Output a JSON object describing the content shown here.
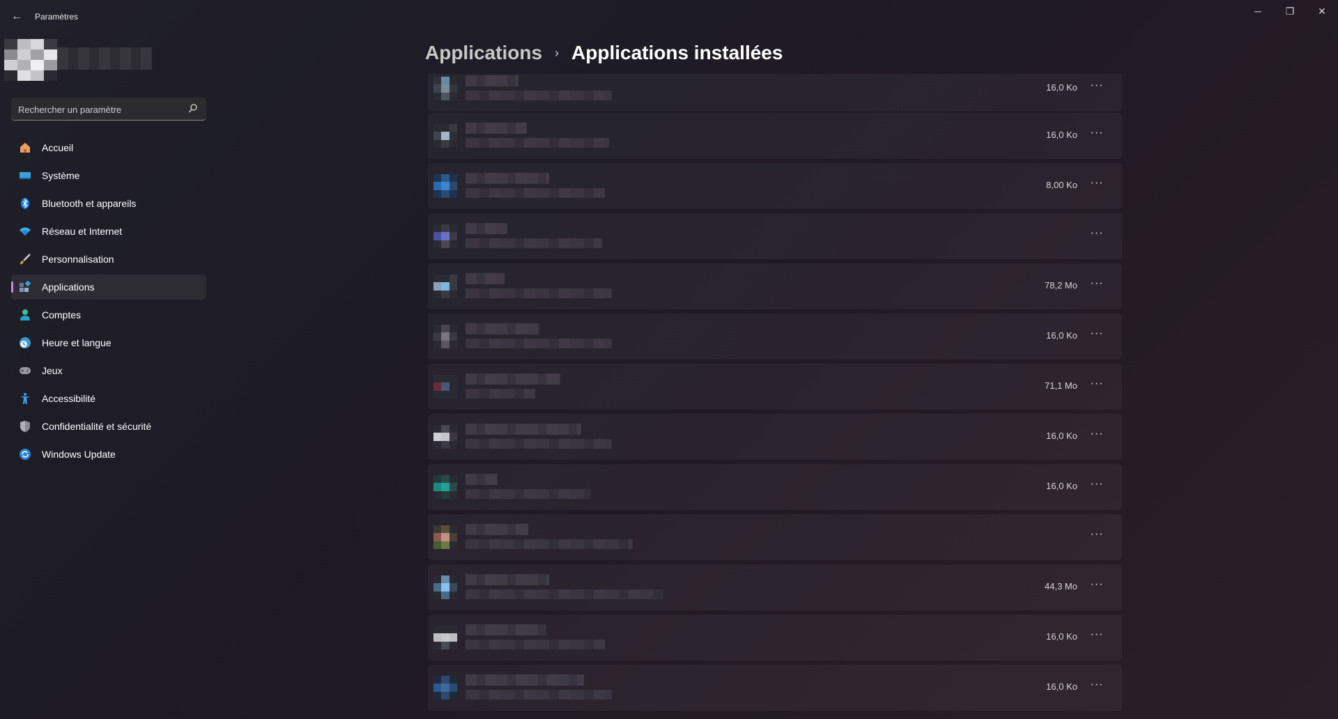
{
  "window": {
    "title": "Paramètres",
    "controls": {
      "minimize": "─",
      "maximize": "❐",
      "close": "✕"
    }
  },
  "search": {
    "placeholder": "Rechercher un paramètre"
  },
  "sidebar": {
    "items": [
      {
        "label": "Accueil",
        "icon": "home-icon",
        "active": false
      },
      {
        "label": "Système",
        "icon": "system-display-icon",
        "active": false
      },
      {
        "label": "Bluetooth et appareils",
        "icon": "bluetooth-icon",
        "active": false
      },
      {
        "label": "Réseau et Internet",
        "icon": "wifi-icon",
        "active": false
      },
      {
        "label": "Personnalisation",
        "icon": "brush-icon",
        "active": false
      },
      {
        "label": "Applications",
        "icon": "apps-icon",
        "active": true
      },
      {
        "label": "Comptes",
        "icon": "account-icon",
        "active": false
      },
      {
        "label": "Heure et langue",
        "icon": "time-language-icon",
        "active": false
      },
      {
        "label": "Jeux",
        "icon": "gamepad-icon",
        "active": false
      },
      {
        "label": "Accessibilité",
        "icon": "accessibility-icon",
        "active": false
      },
      {
        "label": "Confidentialité et sécurité",
        "icon": "shield-icon",
        "active": false
      },
      {
        "label": "Windows Update",
        "icon": "update-icon",
        "active": false
      }
    ]
  },
  "breadcrumb": {
    "parent": "Applications",
    "separator": "›",
    "current": "Applications installées"
  },
  "apps": [
    {
      "size": "16,0 Ko",
      "more": "···",
      "icon_colors": [
        "#30303a",
        "#6a8aa0",
        "#2a2a32",
        "#3d4450",
        "#7a8a9a",
        "#33363e",
        "#2a2a32",
        "#505560",
        "#2a2a32"
      ]
    },
    {
      "size": "16,0 Ko",
      "more": "···",
      "icon_colors": [
        "#2a2a30",
        "#2a2a30",
        "#3a3a44",
        "#40424c",
        "#a4b4cc",
        "#2e2e36",
        "#2a2a30",
        "#383a42",
        "#2a2a30"
      ]
    },
    {
      "size": "8,00 Ko",
      "more": "···",
      "icon_colors": [
        "#1f3350",
        "#2a5a90",
        "#1f3350",
        "#2a6ab0",
        "#3a86d0",
        "#2a4a70",
        "#1f3350",
        "#2a4a70",
        "#1f3350"
      ]
    },
    {
      "size": "",
      "more": "···",
      "icon_colors": [
        "#2a2a32",
        "#3a3a44",
        "#2a2a32",
        "#4a50a0",
        "#6a70c0",
        "#3a3a44",
        "#2a2a32",
        "#4a4650",
        "#2a2a32"
      ]
    },
    {
      "size": "78,2 Mo",
      "more": "···",
      "icon_colors": [
        "#2a2a32",
        "#2a2a32",
        "#3a3a44",
        "#8aa0b8",
        "#7ab8e0",
        "#3a3a44",
        "#2a2a32",
        "#3a3a44",
        "#2a2a32"
      ]
    },
    {
      "size": "16,0 Ko",
      "more": "···",
      "icon_colors": [
        "#2a2a32",
        "#4a4650",
        "#2a2a32",
        "#3a3840",
        "#7a7480",
        "#3a3840",
        "#2a2a32",
        "#5a5460",
        "#2a2a32"
      ]
    },
    {
      "size": "71,1 Mo",
      "more": "···",
      "icon_colors": [
        "#2a2a32",
        "#2a2a32",
        "#2a2a32",
        "#6a2a3a",
        "#4a5878",
        "#2a2a32",
        "#2a2a32",
        "#2a2a32",
        "#2a2a32"
      ]
    },
    {
      "size": "16,0 Ko",
      "more": "···",
      "icon_colors": [
        "#2a2a32",
        "#4a4850",
        "#2a2a32",
        "#d0d0d4",
        "#c4c4ca",
        "#3a3840",
        "#2a2a32",
        "#3a3840",
        "#2a2a32"
      ]
    },
    {
      "size": "16,0 Ko",
      "more": "···",
      "icon_colors": [
        "#1e3a3a",
        "#2a4a4a",
        "#2a2a32",
        "#1a8a80",
        "#22a090",
        "#2a4a4a",
        "#2a2a32",
        "#2a3a3a",
        "#2a2a32"
      ]
    },
    {
      "size": "",
      "more": "···",
      "icon_colors": [
        "#3a3a30",
        "#5a5040",
        "#2a2a32",
        "#8a5a50",
        "#c09080",
        "#4a4038",
        "#4a5a30",
        "#6a7a40",
        "#2a2a32"
      ]
    },
    {
      "size": "44,3 Mo",
      "more": "···",
      "icon_colors": [
        "#2a2a32",
        "#6a8aaa",
        "#2a2a32",
        "#4a6a8a",
        "#8ac0f0",
        "#3a4a5a",
        "#2a2a32",
        "#4a6a8a",
        "#2a2a32"
      ]
    },
    {
      "size": "16,0 Ko",
      "more": "···",
      "icon_colors": [
        "#2a2a32",
        "#2a2a32",
        "#2a2a32",
        "#bdbdc2",
        "#c8c8cc",
        "#bdbdc2",
        "#2a2a32",
        "#4a4a52",
        "#2a2a32"
      ]
    },
    {
      "size": "16,0 Ko",
      "more": "···",
      "icon_colors": [
        "#1e2a3a",
        "#2a4a70",
        "#1e2a3a",
        "#2a5a90",
        "#3a6aa0",
        "#2a4a70",
        "#1e2a3a",
        "#2a4a70",
        "#1e2a3a"
      ]
    }
  ]
}
